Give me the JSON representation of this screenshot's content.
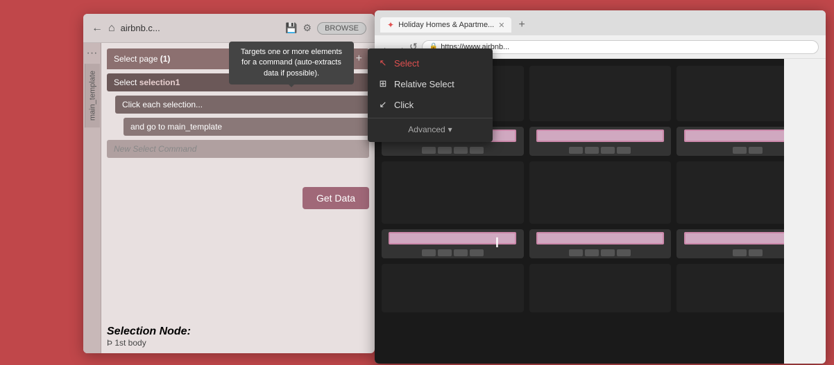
{
  "app": {
    "title": "airbnb.c...",
    "back_icon": "←",
    "home_icon": "⌂",
    "save_icon": "💾",
    "gear_icon": "⚙",
    "browse_label": "BROWSE"
  },
  "sidebar": {
    "label": "main_template",
    "dots": "···"
  },
  "commands": {
    "select_page_label": "Select page",
    "select_page_num": "(1)",
    "plus_icon": "+",
    "cmd1_label": "Select ",
    "cmd1_value": "selection1",
    "cmd2_label": "Click each selection...",
    "cmd3_label": "and go to main_template",
    "cmd4_label": "New Select Command",
    "get_data_label": "Get Data"
  },
  "selection_node": {
    "title": "Selection Node:",
    "value": "Þ 1st body"
  },
  "tooltip": {
    "text": "Targets one or more elements for a command (auto-extracts data if possible)."
  },
  "context_menu": {
    "items": [
      {
        "icon": "↖",
        "label": "Select",
        "active": true
      },
      {
        "icon": "⊞",
        "label": "Relative Select",
        "active": false
      },
      {
        "icon": "↙",
        "label": "Click",
        "active": false
      }
    ],
    "advanced_label": "Advanced",
    "chevron": "▾"
  },
  "browser": {
    "tab_title": "Holiday Homes & Apartme...",
    "tab_favicon": "✦",
    "close_icon": "✕",
    "new_tab_icon": "+",
    "address": "https://www.airbnb...",
    "lock_icon": "🔒",
    "back_icon": "←",
    "forward_icon": "→",
    "refresh_icon": "↺"
  },
  "colors": {
    "accent_red": "#e05050",
    "menu_bg": "#2c2c2c",
    "toolbar_bg": "#8c7070",
    "card_highlight": "#c8a0b8"
  }
}
